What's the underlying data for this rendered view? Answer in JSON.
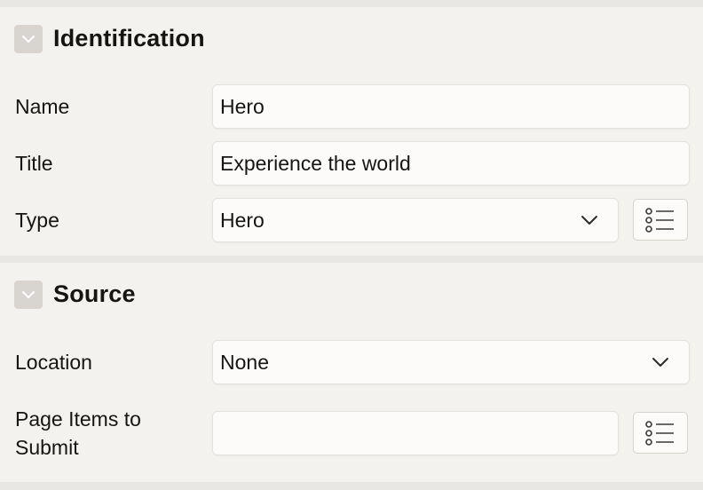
{
  "identification": {
    "title": "Identification",
    "collapse_icon": "chevron-down-icon",
    "name_label": "Name",
    "name_value": "Hero",
    "title_label": "Title",
    "title_value": "Experience the world",
    "type_label": "Type",
    "type_value": "Hero",
    "type_picker_icon": "list-icon"
  },
  "source": {
    "title": "Source",
    "collapse_icon": "chevron-down-icon",
    "location_label": "Location",
    "location_value": "None",
    "page_items_label_line1": "Page Items to",
    "page_items_label_line2": "Submit",
    "page_items_value": "",
    "page_items_picker_icon": "list-icon"
  }
}
